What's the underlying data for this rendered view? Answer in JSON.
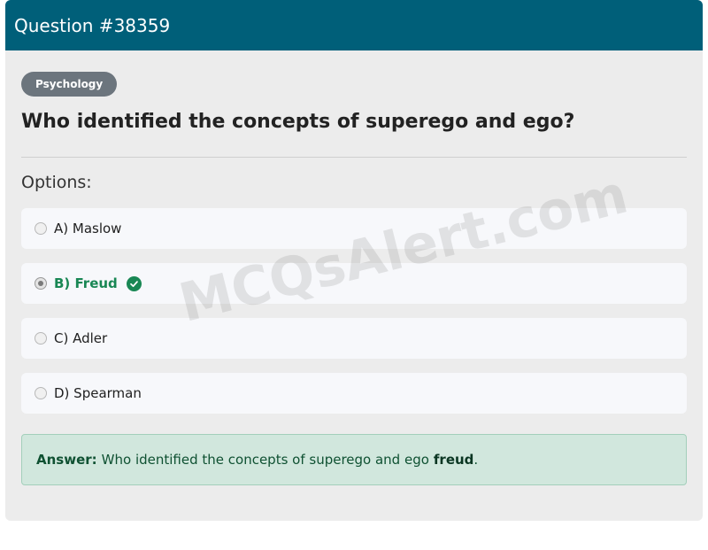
{
  "header": {
    "title": "Question #38359"
  },
  "category": {
    "label": "Psychology"
  },
  "question": {
    "text": "Who identified the concepts of superego and ego?"
  },
  "options_label": "Options:",
  "options": [
    {
      "label": "A) Maslow",
      "selected": false,
      "correct": false
    },
    {
      "label": "B) Freud",
      "selected": true,
      "correct": true
    },
    {
      "label": "C) Adler",
      "selected": false,
      "correct": false
    },
    {
      "label": "D) Spearman",
      "selected": false,
      "correct": false
    }
  ],
  "answer": {
    "prefix": "Answer:",
    "text": "Who identified the concepts of superego and ego",
    "highlight": "freud",
    "suffix": "."
  },
  "watermark": "MCQsAlert.com",
  "colors": {
    "header_bg": "#005f79",
    "correct": "#198754",
    "answer_bg": "#d1e7dd"
  }
}
